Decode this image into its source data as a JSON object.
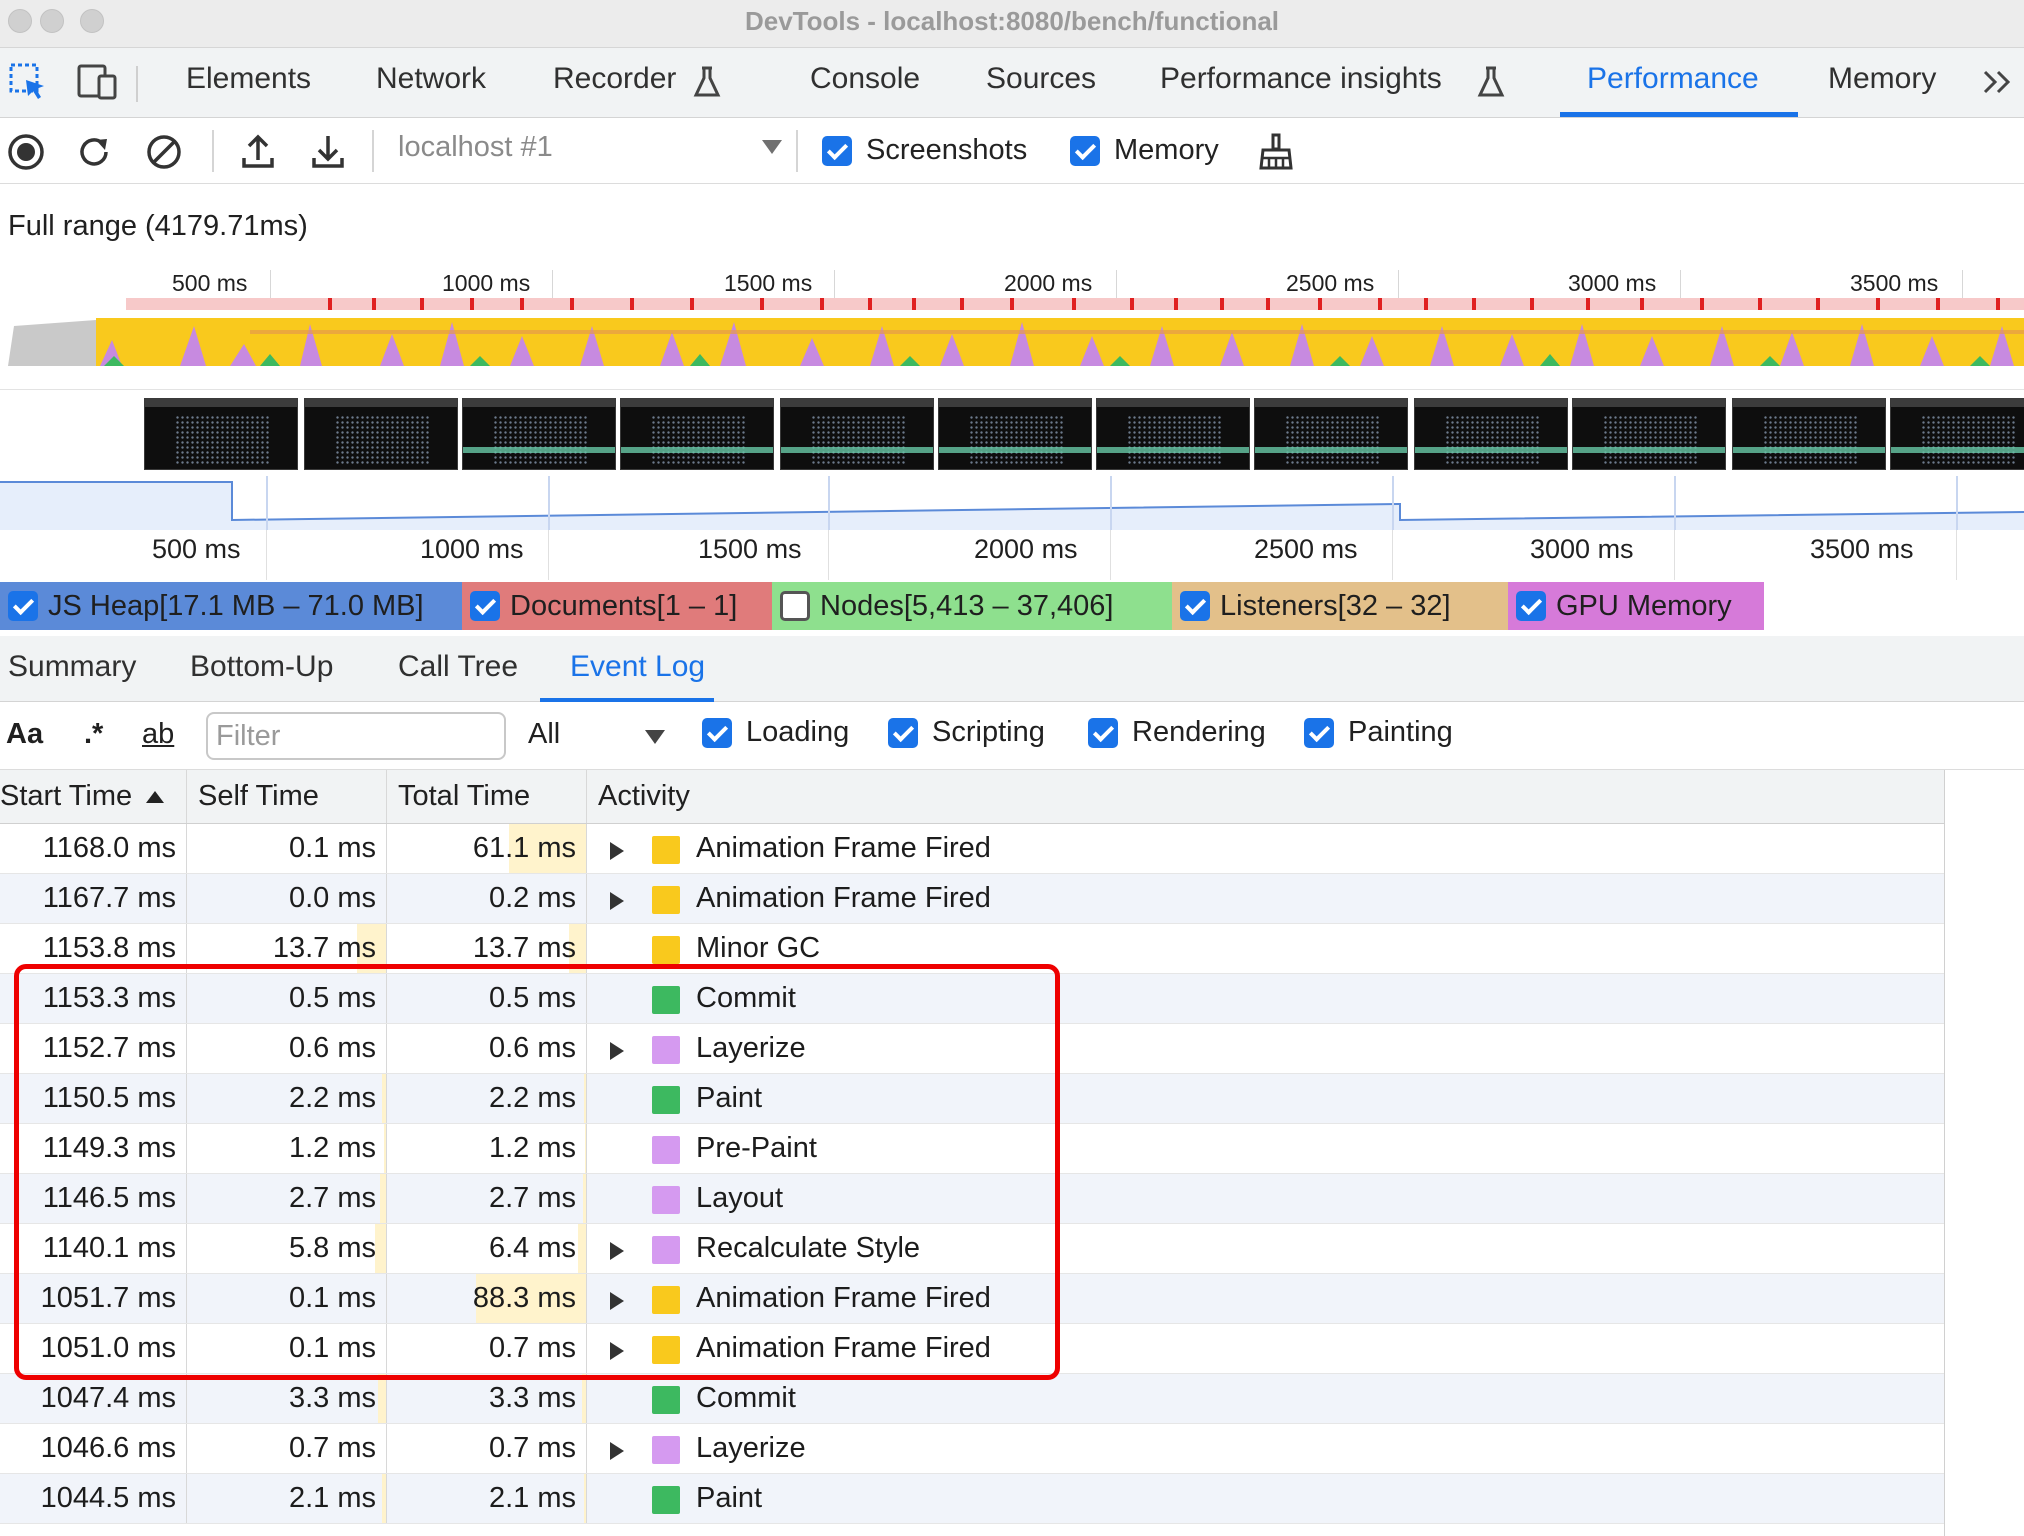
{
  "window": {
    "title": "DevTools - localhost:8080/bench/functional"
  },
  "main_tabs": [
    {
      "label": "Elements",
      "active": false
    },
    {
      "label": "Network",
      "active": false
    },
    {
      "label": "Recorder",
      "active": false,
      "experimental": true
    },
    {
      "label": "Console",
      "active": false
    },
    {
      "label": "Sources",
      "active": false
    },
    {
      "label": "Performance insights",
      "active": false,
      "experimental": true
    },
    {
      "label": "Performance",
      "active": true
    },
    {
      "label": "Memory",
      "active": false
    }
  ],
  "toolbar": {
    "profile_select": "localhost #1",
    "screenshots_label": "Screenshots",
    "screenshots_checked": true,
    "memory_label": "Memory",
    "memory_checked": true
  },
  "overview": {
    "range_label": "Full range (4179.71ms)",
    "ruler_ticks": [
      "500 ms",
      "1000 ms",
      "1500 ms",
      "2000 ms",
      "2500 ms",
      "3000 ms",
      "3500 ms"
    ],
    "memory_ruler_ticks": [
      "500 ms",
      "1000 ms",
      "1500 ms",
      "2000 ms",
      "2500 ms",
      "3000 ms",
      "3500 ms"
    ]
  },
  "counters": [
    {
      "label": "JS Heap[17.1 MB – 71.0 MB]",
      "checked": true,
      "color": "#5b8ad8"
    },
    {
      "label": "Documents[1 – 1]",
      "checked": true,
      "color": "#e07b7b"
    },
    {
      "label": "Nodes[5,413 – 37,406]",
      "checked": false,
      "color": "#8ee08e"
    },
    {
      "label": "Listeners[32 – 32]",
      "checked": true,
      "color": "#e3c08a"
    },
    {
      "label": "GPU Memory",
      "checked": true,
      "color": "#d67ad9"
    }
  ],
  "sub_tabs": [
    {
      "label": "Summary",
      "active": false
    },
    {
      "label": "Bottom-Up",
      "active": false
    },
    {
      "label": "Call Tree",
      "active": false
    },
    {
      "label": "Event Log",
      "active": true
    }
  ],
  "filter_bar": {
    "match_case": "Aa",
    "regex": ".*",
    "whole_word": "ab",
    "filter_placeholder": "Filter",
    "duration_select": "All",
    "categories": [
      {
        "label": "Loading",
        "checked": true
      },
      {
        "label": "Scripting",
        "checked": true
      },
      {
        "label": "Rendering",
        "checked": true
      },
      {
        "label": "Painting",
        "checked": true
      }
    ]
  },
  "table": {
    "headers": {
      "start": "Start Time",
      "self": "Self Time",
      "total": "Total Time",
      "activity": "Activity"
    },
    "colors": {
      "scripting": "#f9c91d",
      "rendering": "#d59af0",
      "painting": "#3db960"
    },
    "rows": [
      {
        "start": "1168.0 ms",
        "self": "0.1 ms",
        "total": "61.1 ms",
        "activity": "Animation Frame Fired",
        "category": "scripting",
        "expandable": true,
        "self_frac": 0.0,
        "total_frac": 0.7
      },
      {
        "start": "1167.7 ms",
        "self": "0.0 ms",
        "total": "0.2 ms",
        "activity": "Animation Frame Fired",
        "category": "scripting",
        "expandable": true,
        "self_frac": 0.0,
        "total_frac": 0.0
      },
      {
        "start": "1153.8 ms",
        "self": "13.7 ms",
        "total": "13.7 ms",
        "activity": "Minor GC",
        "category": "scripting",
        "expandable": false,
        "self_frac": 0.15,
        "total_frac": 0.15
      },
      {
        "start": "1153.3 ms",
        "self": "0.5 ms",
        "total": "0.5 ms",
        "activity": "Commit",
        "category": "painting",
        "expandable": false,
        "self_frac": 0.0,
        "total_frac": 0.0
      },
      {
        "start": "1152.7 ms",
        "self": "0.6 ms",
        "total": "0.6 ms",
        "activity": "Layerize",
        "category": "rendering",
        "expandable": true,
        "self_frac": 0.0,
        "total_frac": 0.0
      },
      {
        "start": "1150.5 ms",
        "self": "2.2 ms",
        "total": "2.2 ms",
        "activity": "Paint",
        "category": "painting",
        "expandable": false,
        "self_frac": 0.02,
        "total_frac": 0.02
      },
      {
        "start": "1149.3 ms",
        "self": "1.2 ms",
        "total": "1.2 ms",
        "activity": "Pre-Paint",
        "category": "rendering",
        "expandable": false,
        "self_frac": 0.01,
        "total_frac": 0.01
      },
      {
        "start": "1146.5 ms",
        "self": "2.7 ms",
        "total": "2.7 ms",
        "activity": "Layout",
        "category": "rendering",
        "expandable": false,
        "self_frac": 0.03,
        "total_frac": 0.03
      },
      {
        "start": "1140.1 ms",
        "self": "5.8 ms",
        "total": "6.4 ms",
        "activity": "Recalculate Style",
        "category": "rendering",
        "expandable": true,
        "self_frac": 0.06,
        "total_frac": 0.07
      },
      {
        "start": "1051.7 ms",
        "self": "0.1 ms",
        "total": "88.3 ms",
        "activity": "Animation Frame Fired",
        "category": "scripting",
        "expandable": true,
        "self_frac": 0.0,
        "total_frac": 1.0
      },
      {
        "start": "1051.0 ms",
        "self": "0.1 ms",
        "total": "0.7 ms",
        "activity": "Animation Frame Fired",
        "category": "scripting",
        "expandable": true,
        "self_frac": 0.0,
        "total_frac": 0.0
      },
      {
        "start": "1047.4 ms",
        "self": "3.3 ms",
        "total": "3.3 ms",
        "activity": "Commit",
        "category": "painting",
        "expandable": false,
        "self_frac": 0.04,
        "total_frac": 0.04
      },
      {
        "start": "1046.6 ms",
        "self": "0.7 ms",
        "total": "0.7 ms",
        "activity": "Layerize",
        "category": "rendering",
        "expandable": true,
        "self_frac": 0.0,
        "total_frac": 0.0
      },
      {
        "start": "1044.5 ms",
        "self": "2.1 ms",
        "total": "2.1 ms",
        "activity": "Paint",
        "category": "painting",
        "expandable": false,
        "self_frac": 0.02,
        "total_frac": 0.02
      }
    ]
  }
}
